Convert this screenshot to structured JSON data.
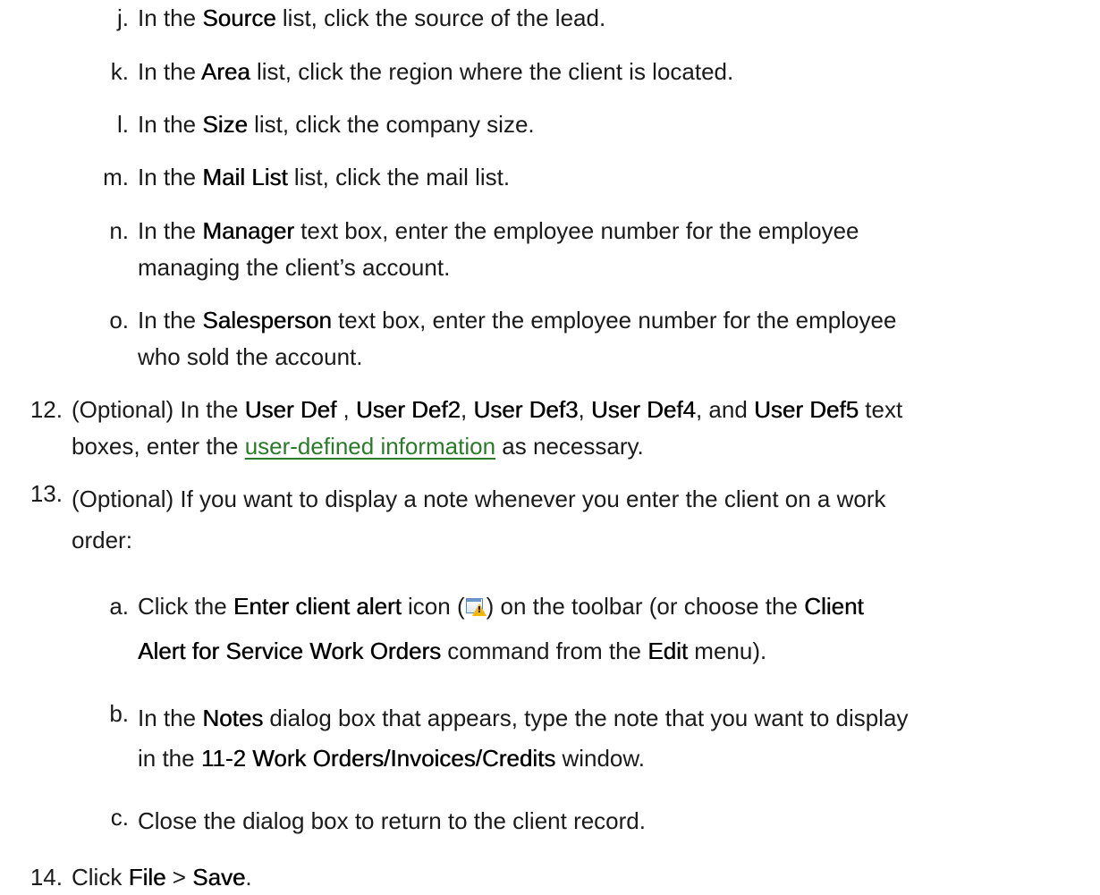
{
  "steps": {
    "j": {
      "marker": "j.",
      "t1": "In the ",
      "b1": "Source",
      "t2": " list, click the source of the lead."
    },
    "k": {
      "marker": "k.",
      "t1": "In the ",
      "b1": "Area",
      "t2": " list, click the region where the client is located."
    },
    "l": {
      "marker": "l.",
      "t1": "In the ",
      "b1": "Size",
      "t2": " list, click the company size."
    },
    "m": {
      "marker": "m.",
      "t1": "In the ",
      "b1": "Mail List",
      "t2": " list, click the mail list."
    },
    "n": {
      "marker": "n.",
      "t1": "In the ",
      "b1": "Manager",
      "t2": " text box, enter the employee number for the employee",
      "line2": "managing the client’s account."
    },
    "o": {
      "marker": "o.",
      "t1": "In the ",
      "b1": "Salesperson",
      "t2": " text box, enter the employee number for the employee",
      "line2": "who sold the account."
    },
    "s12": {
      "marker": "12.",
      "t1": "(Optional) In the ",
      "b1": "User Def",
      "t2": " , ",
      "b2": "User Def2",
      "t3": ", ",
      "b3": "User Def3",
      "t4": ", ",
      "b4": "User Def4",
      "t5": ", and ",
      "b5": "User Def5",
      "t6": " text",
      "l2a": "boxes, enter the ",
      "link": "user-defined information",
      "l2b": " as necessary."
    },
    "s13": {
      "marker": "13.",
      "line1": "(Optional) If you want to display a note whenever you enter the client on a work",
      "line2": "order:"
    },
    "a": {
      "marker": "a.",
      "t1": "Click the ",
      "b1": "Enter client alert",
      "t2": " icon (",
      "t3": ") on the toolbar (or choose the ",
      "b2": "Client",
      "b3": "Alert for Service Work Orders",
      "t4": " command from the ",
      "b4": "Edit",
      "t5": " menu)."
    },
    "b": {
      "marker": "b.",
      "t1": "In the ",
      "b1": "Notes",
      "t2": " dialog box that appears, type the note that you want to display",
      "l2a": "in the ",
      "b2": "11-2 Work Orders/Invoices/Credits",
      "l2b": " window."
    },
    "c": {
      "marker": "c.",
      "t1": "Close the dialog box to return to the client record."
    },
    "s14": {
      "marker": "14.",
      "t1": "Click ",
      "b1": "File",
      "t2": " > ",
      "b2": "Save",
      "t3": "."
    }
  }
}
